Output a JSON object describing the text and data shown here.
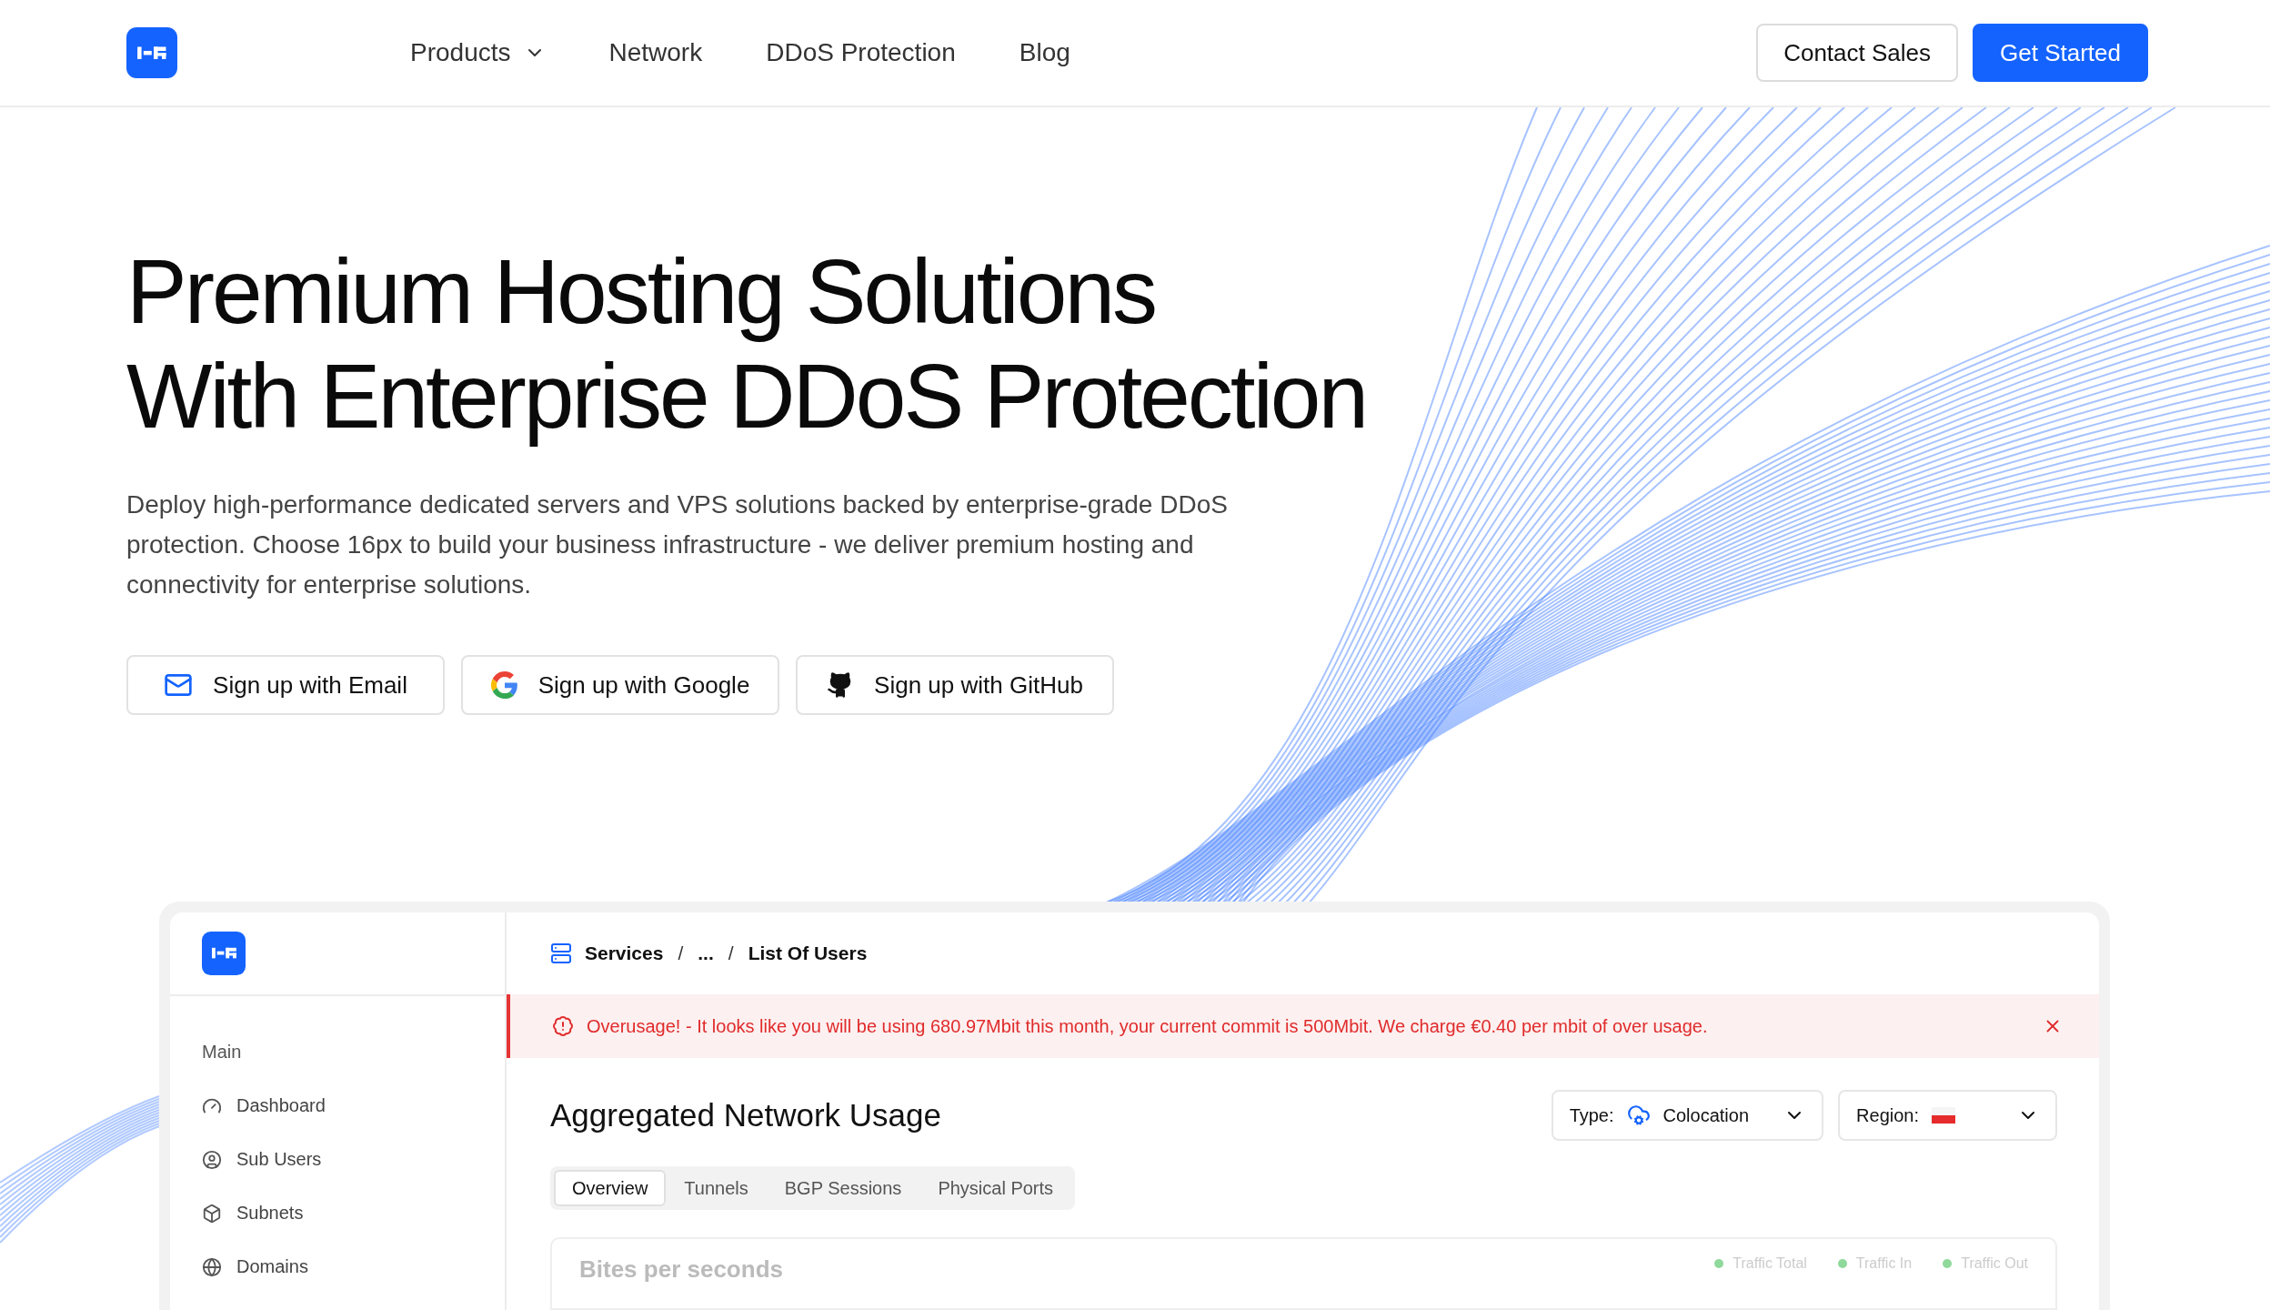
{
  "header": {
    "nav": [
      {
        "label": "Products",
        "has_menu": true
      },
      {
        "label": "Network",
        "has_menu": false
      },
      {
        "label": "DDoS Protection",
        "has_menu": false
      },
      {
        "label": "Blog",
        "has_menu": false
      }
    ],
    "buttons": [
      {
        "label": "Contact Sales",
        "kind": "outline"
      },
      {
        "label": "Get Started",
        "kind": "primary"
      }
    ]
  },
  "hero": {
    "title_lines": [
      "Premium Hosting Solutions",
      "With Enterprise DDoS Protection"
    ],
    "description": "Deploy high-performance dedicated servers and VPS solutions backed by enterprise-grade DDoS protection. Choose 16px to build your business infrastructure - we deliver premium hosting and connectivity for enterprise solutions.",
    "signup_buttons": [
      {
        "label": "Sign up with Email",
        "kind": "email"
      },
      {
        "label": "Sign up with Google",
        "kind": "google"
      },
      {
        "label": "Sign up with GitHub",
        "kind": "github"
      }
    ]
  },
  "dashboard": {
    "sidebar": {
      "section": "Main",
      "items": [
        {
          "label": "Dashboard",
          "kind": "dashboard"
        },
        {
          "label": "Sub Users",
          "kind": "users"
        },
        {
          "label": "Subnets",
          "kind": "subnets"
        },
        {
          "label": "Domains",
          "kind": "domains"
        }
      ]
    },
    "breadcrumb": [
      {
        "text": "Services",
        "kind": "link"
      },
      {
        "text": "/",
        "kind": "separator"
      },
      {
        "text": "...",
        "kind": "link"
      },
      {
        "text": "/",
        "kind": "separator"
      },
      {
        "text": "List Of Users",
        "kind": "link"
      }
    ],
    "alert": {
      "text": "Overusage! - It looks like you will be using 680.97Mbit this month, your current commit is 500Mbit. We charge €0.40 per mbit of over usage."
    },
    "title": "Aggregated Network Usage",
    "filters": [
      {
        "label": "Type:",
        "value": "Colocation",
        "kind": "type"
      },
      {
        "label": "Region:",
        "kind": "region"
      }
    ],
    "tabs": [
      {
        "label": "Overview",
        "selected": true
      },
      {
        "label": "Tunnels",
        "selected": false
      },
      {
        "label": "BGP Sessions",
        "selected": false
      },
      {
        "label": "Physical Ports",
        "selected": false
      }
    ],
    "chart_card": {
      "title": "Bites per seconds",
      "legend": [
        "Traffic Total",
        "Traffic In",
        "Traffic Out"
      ]
    }
  }
}
